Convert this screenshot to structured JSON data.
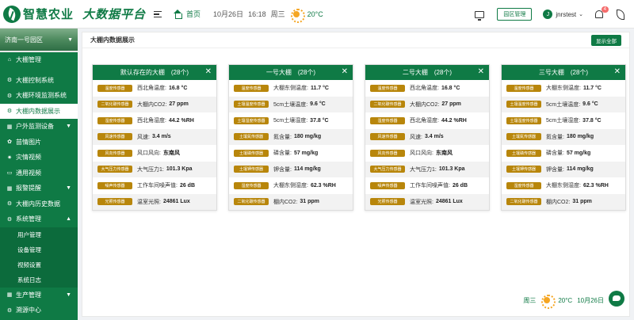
{
  "header": {
    "logo_text": "智慧农业",
    "platform_title": "大数据平台",
    "home_label": "首页",
    "date": "10月26日",
    "time": "16:18",
    "weekday": "周三",
    "temperature": "20°C",
    "park_manage_label": "园区管理",
    "avatar_letter": "J",
    "username": "jnrstest",
    "notification_count": "4"
  },
  "sidebar": {
    "park_name": "济南一号园区",
    "items": [
      {
        "label": "大棚管理",
        "icon": "home-icon",
        "arrow": ""
      },
      {
        "label": "大棚控制系统",
        "icon": "gear-icon",
        "arrow": ""
      },
      {
        "label": "大棚环境监测系统",
        "icon": "gear-icon",
        "arrow": ""
      },
      {
        "label": "大棚内数据展示",
        "icon": "gear-icon",
        "arrow": ""
      },
      {
        "label": "户外监测设备",
        "icon": "grid-icon",
        "arrow": "▼"
      },
      {
        "label": "苗情图片",
        "icon": "flower-icon",
        "arrow": ""
      },
      {
        "label": "灾情视频",
        "icon": "alert-icon",
        "arrow": ""
      },
      {
        "label": "通用视频",
        "icon": "video-icon",
        "arrow": ""
      },
      {
        "label": "报警提醒",
        "icon": "grid-icon",
        "arrow": "▼"
      },
      {
        "label": "大棚内历史数据",
        "icon": "gear-icon",
        "arrow": ""
      },
      {
        "label": "系统管理",
        "icon": "gear-icon",
        "arrow": "▲"
      }
    ],
    "sub_items": [
      "用户管理",
      "设备管理",
      "视频设置",
      "系统日志"
    ],
    "bottom_items": [
      {
        "label": "生产管理",
        "icon": "grid-icon",
        "arrow": "▼"
      },
      {
        "label": "溯源中心",
        "icon": "gear-icon",
        "arrow": ""
      }
    ]
  },
  "main": {
    "title": "大棚内数据展示",
    "show_all_label": "显示全部"
  },
  "cards": [
    {
      "title": "默认存在的大棚　(28个)",
      "rows": [
        {
          "tag": "温度传感器",
          "label": "西北角温度:",
          "value": "16.8 °C"
        },
        {
          "tag": "二氧化碳传感器",
          "label": "大棚内CO2:",
          "value": "27 ppm"
        },
        {
          "tag": "湿度传感器",
          "label": "西北角湿度:",
          "value": "44.2 %RH"
        },
        {
          "tag": "风速传感器",
          "label": "风速:",
          "value": "3.4 m/s"
        },
        {
          "tag": "风向传感器",
          "label": "风口风向:",
          "value": "东南风"
        },
        {
          "tag": "大气压力传感器",
          "label": "大气压力1:",
          "value": "101.3 Kpa"
        },
        {
          "tag": "噪声传感器",
          "label": "工作车间噪声值:",
          "value": "26 dB"
        },
        {
          "tag": "光照传感器",
          "label": "温室光照:",
          "value": "24861 Lux"
        }
      ]
    },
    {
      "title": "一号大棚　(28个)",
      "rows": [
        {
          "tag": "温度传感器",
          "label": "大棚东侧温度:",
          "value": "11.7 °C"
        },
        {
          "tag": "土壤温度传感器",
          "label": "5cm土壤温度:",
          "value": "9.6 °C"
        },
        {
          "tag": "土壤湿度传感器",
          "label": "5cm土壤湿度:",
          "value": "37.8 °C"
        },
        {
          "tag": "土壤氮传感器",
          "label": "氮含量:",
          "value": "180 mg/kg"
        },
        {
          "tag": "土壤磷传感器",
          "label": "磷含量:",
          "value": "57 mg/kg"
        },
        {
          "tag": "土壤钾传感器",
          "label": "钾含量:",
          "value": "114 mg/kg"
        },
        {
          "tag": "湿度传感器",
          "label": "大棚东侧湿度:",
          "value": "62.3 %RH"
        },
        {
          "tag": "二氧化碳传感器",
          "label": "棚内CO2:",
          "value": "31 ppm"
        }
      ]
    },
    {
      "title": "二号大棚　(28个)",
      "rows": [
        {
          "tag": "温度传感器",
          "label": "西北角温度:",
          "value": "16.8 °C"
        },
        {
          "tag": "二氧化碳传感器",
          "label": "大棚内CO2:",
          "value": "27 ppm"
        },
        {
          "tag": "湿度传感器",
          "label": "西北角湿度:",
          "value": "44.2 %RH"
        },
        {
          "tag": "风速传感器",
          "label": "风速:",
          "value": "3.4 m/s"
        },
        {
          "tag": "风向传感器",
          "label": "风口风向:",
          "value": "东南风"
        },
        {
          "tag": "大气压力传感器",
          "label": "大气压力1:",
          "value": "101.3 Kpa"
        },
        {
          "tag": "噪声传感器",
          "label": "工作车间噪声值:",
          "value": "26 dB"
        },
        {
          "tag": "光照传感器",
          "label": "温室光照:",
          "value": "24861 Lux"
        }
      ]
    },
    {
      "title": "三号大棚　(28个)",
      "rows": [
        {
          "tag": "温度传感器",
          "label": "大棚东侧温度:",
          "value": "11.7 °C"
        },
        {
          "tag": "土壤温度传感器",
          "label": "5cm土壤温度:",
          "value": "9.6 °C"
        },
        {
          "tag": "土壤湿度传感器",
          "label": "5cm土壤湿度:",
          "value": "37.8 °C"
        },
        {
          "tag": "土壤氮传感器",
          "label": "氮含量:",
          "value": "180 mg/kg"
        },
        {
          "tag": "土壤磷传感器",
          "label": "磷含量:",
          "value": "57 mg/kg"
        },
        {
          "tag": "土壤钾传感器",
          "label": "钾含量:",
          "value": "114 mg/kg"
        },
        {
          "tag": "湿度传感器",
          "label": "大棚东侧湿度:",
          "value": "62.3 %RH"
        },
        {
          "tag": "二氧化碳传感器",
          "label": "棚内CO2:",
          "value": "31 ppm"
        }
      ]
    }
  ],
  "footer": {
    "weekday": "周三",
    "temperature": "20°C",
    "date": "10月26日"
  },
  "colors": {
    "brand_green": "#0f7a45",
    "tag_gold": "#b8860b",
    "badge_red": "#f56c6c"
  }
}
